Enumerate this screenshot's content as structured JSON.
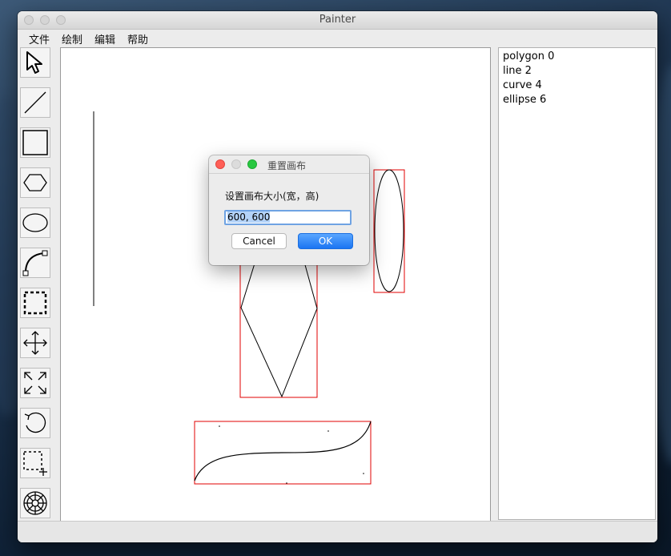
{
  "window": {
    "title": "Painter"
  },
  "menu": [
    "文件",
    "绘制",
    "编辑",
    "帮助"
  ],
  "tools": [
    {
      "name": "select-tool",
      "icon": "arrow-pointer-icon"
    },
    {
      "name": "line-tool",
      "icon": "line-icon"
    },
    {
      "name": "rectangle-tool",
      "icon": "rectangle-icon"
    },
    {
      "name": "polygon-tool",
      "icon": "hexagon-icon"
    },
    {
      "name": "ellipse-tool",
      "icon": "ellipse-icon"
    },
    {
      "name": "curve-tool",
      "icon": "bezier-curve-icon"
    },
    {
      "name": "clip-tool",
      "icon": "dashed-rectangle-icon"
    },
    {
      "name": "move-tool",
      "icon": "move-arrows-icon"
    },
    {
      "name": "scale-tool",
      "icon": "scale-arrows-icon"
    },
    {
      "name": "rotate-tool",
      "icon": "rotate-icon"
    },
    {
      "name": "add-canvas-tool",
      "icon": "dashed-rectangle-plus-icon"
    },
    {
      "name": "settings-tool",
      "icon": "wheel-icon"
    }
  ],
  "object_list": [
    "polygon 0",
    "line 2",
    "curve 4",
    "ellipse 6"
  ],
  "dialog": {
    "title": "重置画布",
    "prompt": "设置画布大小(宽，高)",
    "value": "600, 600",
    "cancel_label": "Cancel",
    "ok_label": "OK"
  },
  "colors": {
    "selection_border": "#e00000",
    "accent": "#1b75f2",
    "close_dot": "#ff5f57",
    "zoom_dot": "#28c840"
  }
}
